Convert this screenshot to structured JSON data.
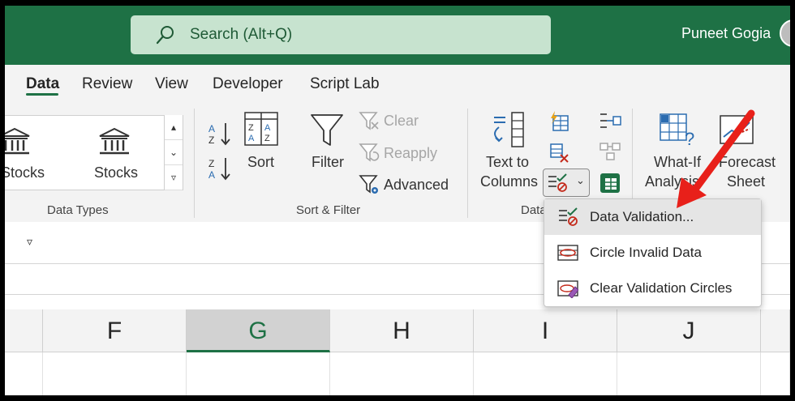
{
  "search": {
    "placeholder": "Search (Alt+Q)"
  },
  "user": {
    "name": "Puneet Gogia"
  },
  "tabs": [
    {
      "label": "Data",
      "active": true
    },
    {
      "label": "Review"
    },
    {
      "label": "View"
    },
    {
      "label": "Developer"
    },
    {
      "label": "Script Lab"
    }
  ],
  "ribbon": {
    "data_types": {
      "group_label": "Data Types",
      "stocks_partial": "Stocks",
      "stocks": "Stocks"
    },
    "sort_filter": {
      "group_label": "Sort & Filter",
      "sort": "Sort",
      "filter": "Filter",
      "clear": "Clear",
      "reapply": "Reapply",
      "advanced": "Advanced"
    },
    "data_tools": {
      "group_label_partial": "Data",
      "text_to_columns_1": "Text to",
      "text_to_columns_2": "Columns"
    },
    "forecast": {
      "whatif_1": "What-If",
      "whatif_2": "Analysis",
      "forecast_1": "Forecast",
      "forecast_2": "Sheet"
    }
  },
  "menu": {
    "items": [
      {
        "label": "Data Validation...",
        "highlighted": true
      },
      {
        "label": "Circle Invalid Data"
      },
      {
        "label": "Clear Validation Circles"
      }
    ]
  },
  "grid": {
    "columns": [
      "F",
      "G",
      "H",
      "I",
      "J"
    ],
    "selected_column": "G"
  },
  "colors": {
    "brand": "#1e7145",
    "search_bg": "#c7e3cf",
    "arrow": "#e8201a"
  }
}
